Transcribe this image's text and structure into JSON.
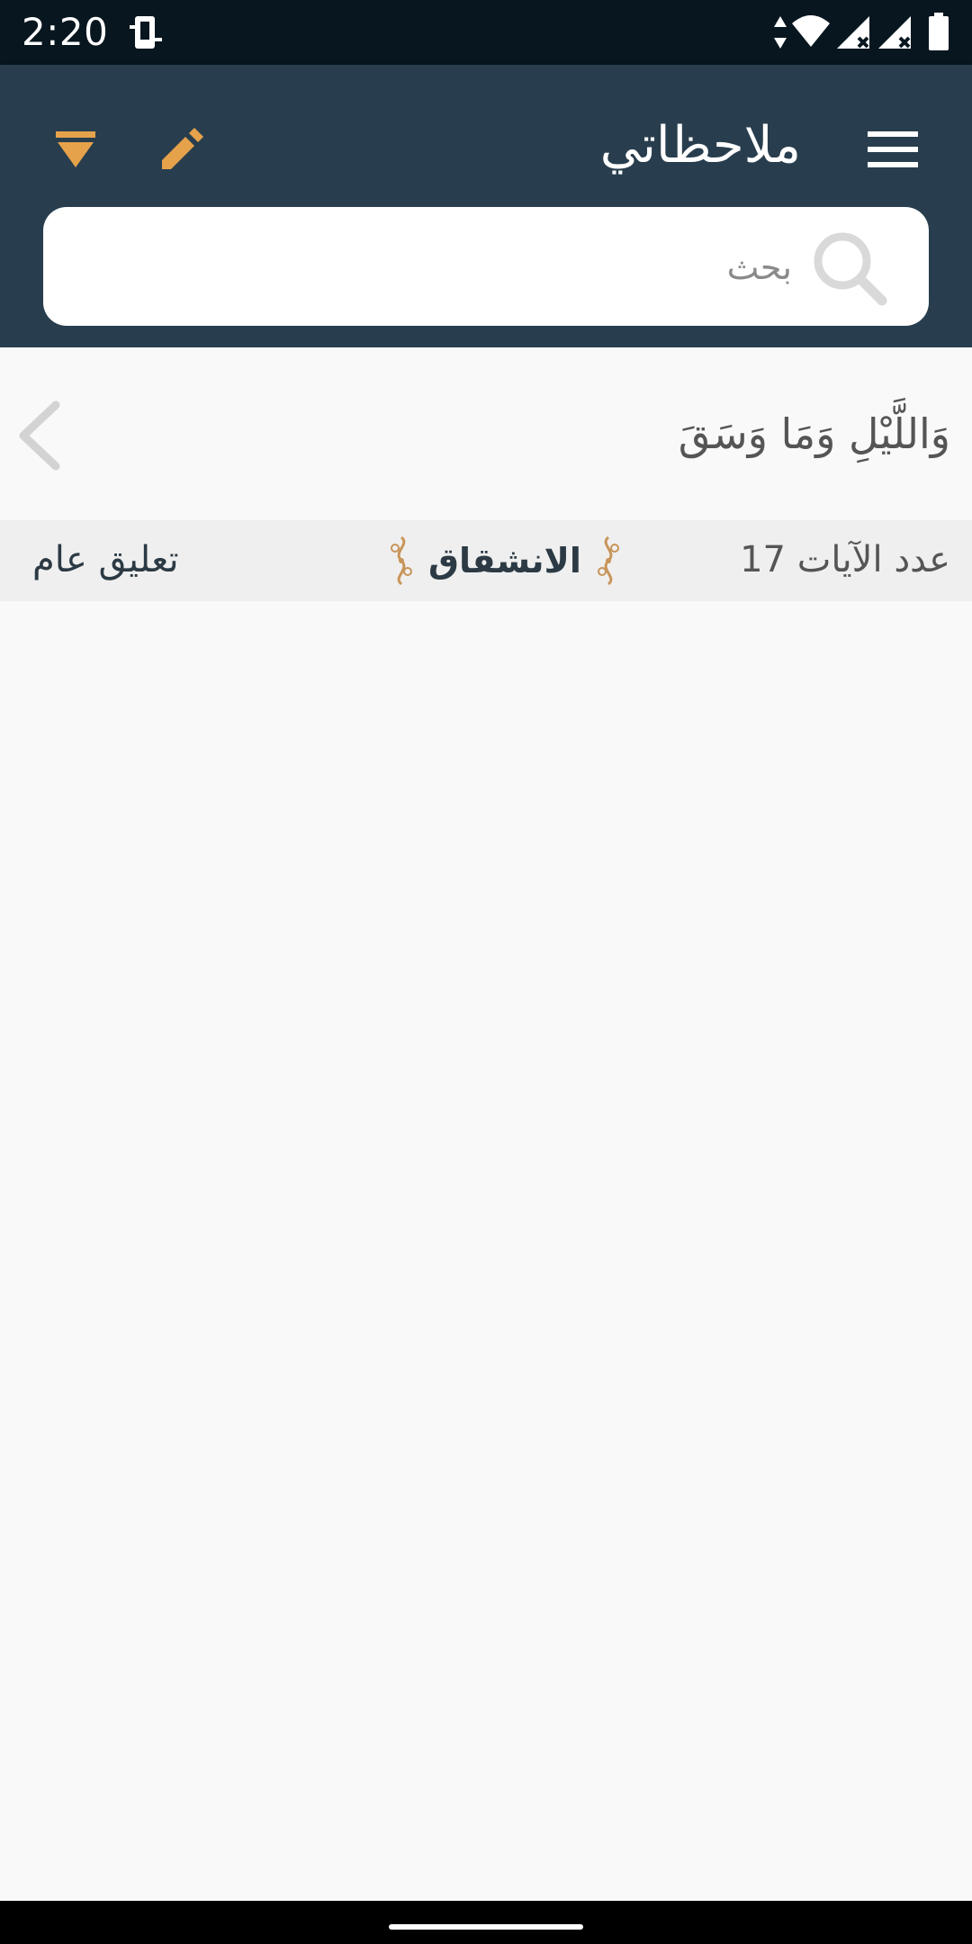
{
  "status_bar": {
    "time": "2:20",
    "icons": [
      "device-icon",
      "data-arrows-icon",
      "wifi-icon",
      "signal-icon",
      "signal-icon",
      "battery-icon"
    ]
  },
  "app_bar": {
    "title": "ملاحظاتي",
    "menu_icon": "hamburger-menu-icon",
    "edit_icon": "pencil-icon",
    "filter_icon": "filter-icon",
    "accent_color": "#e6a24a",
    "background_color": "#283e4e"
  },
  "search": {
    "placeholder": "بحث",
    "value": "",
    "icon": "search-icon"
  },
  "note": {
    "verse": "وَاللَّيْلِ وَمَا وَسَقَ",
    "ayat_count": "عدد الآيات 17",
    "surah": "الانشقاق",
    "comment_type": "تعليق عام",
    "chevron_icon": "chevron-left-icon"
  }
}
